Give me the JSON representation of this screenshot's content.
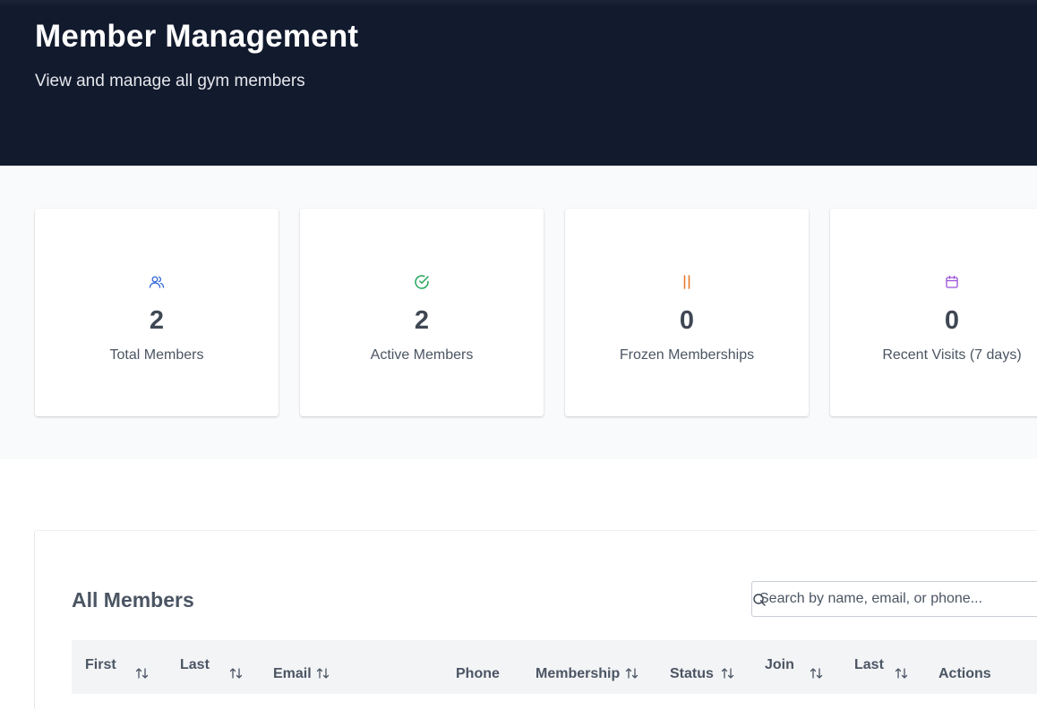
{
  "header": {
    "title": "Member Management",
    "subtitle": "View and manage all gym members"
  },
  "stats": [
    {
      "icon": "users-icon",
      "value": "2",
      "label": "Total Members",
      "color": "#3b6fd8"
    },
    {
      "icon": "check-circle-icon",
      "value": "2",
      "label": "Active Members",
      "color": "#22a55a"
    },
    {
      "icon": "pause-icon",
      "value": "0",
      "label": "Frozen Memberships",
      "color": "#e8792b"
    },
    {
      "icon": "calendar-icon",
      "value": "0",
      "label": "Recent Visits (7 days)",
      "color": "#9b4fd9"
    }
  ],
  "members": {
    "title": "All Members",
    "search": {
      "placeholder": "Search by name, email, or phone...",
      "value": ""
    },
    "columns": [
      {
        "label": "First",
        "label2": "",
        "sortable": true
      },
      {
        "label": "Last",
        "label2": "",
        "sortable": true
      },
      {
        "label": "Email",
        "label2": "",
        "sortable": true
      },
      {
        "label": "Phone",
        "label2": "",
        "sortable": false
      },
      {
        "label": "Membership",
        "label2": "",
        "sortable": true
      },
      {
        "label": "Status",
        "label2": "",
        "sortable": true
      },
      {
        "label": "Join",
        "label2": "",
        "sortable": true
      },
      {
        "label": "Last",
        "label2": "",
        "sortable": true
      },
      {
        "label": "Actions",
        "label2": "",
        "sortable": false
      }
    ]
  }
}
